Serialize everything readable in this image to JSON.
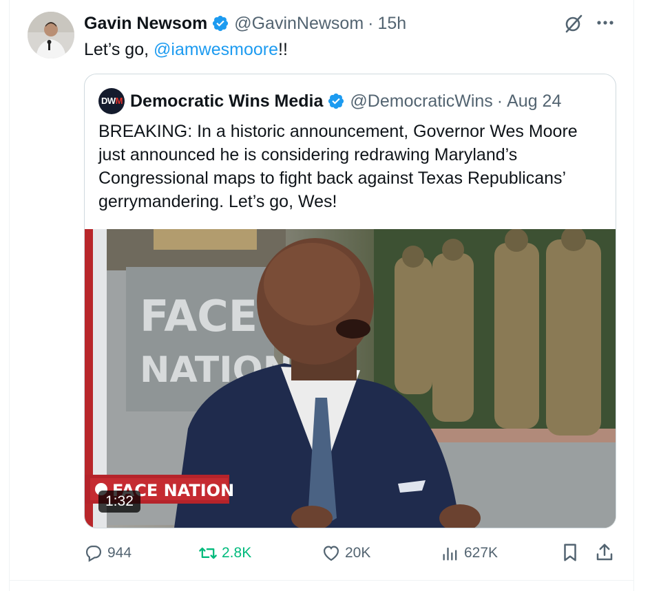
{
  "tweet": {
    "author_name": "Gavin Newsom",
    "author_handle": "@GavinNewsom",
    "separator": "·",
    "timestamp": "15h",
    "text_before": "Let’s go, ",
    "mention": "@iamwesmoore",
    "text_after": "!!"
  },
  "quote": {
    "logo_text_a": "DW",
    "logo_text_b": "M",
    "author_name": "Democratic Wins Media",
    "author_handle": "@DemocraticWins",
    "separator": "·",
    "timestamp": "Aug 24",
    "text": "BREAKING: In a historic announcement, Governor Wes Moore just announced he is considering redrawing Maryland’s Congressional maps to fight back against Texas Republicans’ gerrymandering. Let’s go, Wes!"
  },
  "video": {
    "backdrop_lines": [
      "FACE",
      "NATION"
    ],
    "lower_third_label": "FACE NATION",
    "duration": "1:32"
  },
  "actions": {
    "replies": "944",
    "reposts": "2.8K",
    "likes": "20K",
    "views": "627K"
  },
  "icons": {
    "verified": "verified-badge-icon",
    "grok": "grok-icon",
    "more": "more-icon",
    "reply": "reply-icon",
    "repost": "repost-icon",
    "like": "heart-icon",
    "views": "views-icon",
    "bookmark": "bookmark-icon",
    "share": "share-icon"
  },
  "colors": {
    "link": "#1d9bf0",
    "secondary_text": "#536471",
    "repost_green": "#00ba7c",
    "verified_blue": "#1d9bf0"
  }
}
